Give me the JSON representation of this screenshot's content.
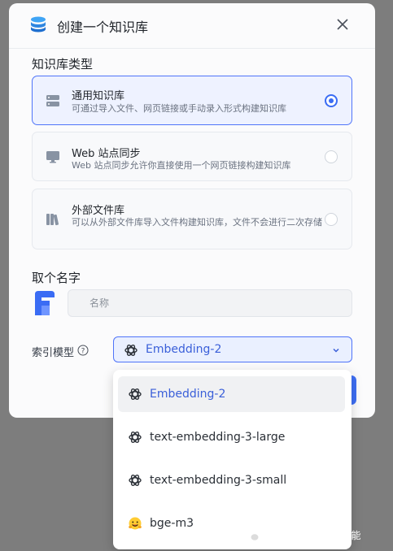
{
  "modal": {
    "title": "创建一个知识库",
    "icons": {
      "logo": "database-stack-icon",
      "close": "close-icon"
    }
  },
  "kb_type": {
    "section_title": "知识库类型",
    "options": [
      {
        "name": "通用知识库",
        "desc": "可通过导入文件、网页链接或手动录入形式构建知识库",
        "selected": true,
        "icon": "server-icon"
      },
      {
        "name": "Web 站点同步",
        "desc": "Web 站点同步允许你直接使用一个网页链接构建知识库",
        "selected": false,
        "icon": "monitor-icon"
      },
      {
        "name": "外部文件库",
        "desc": "可以从外部文件库导入文件构建知识库，文件不会进行二次存储",
        "selected": false,
        "icon": "library-icon"
      }
    ]
  },
  "name_section": {
    "title": "取个名字",
    "placeholder": "名称",
    "value": ""
  },
  "index_model": {
    "label": "索引模型",
    "selected": "Embedding-2",
    "options": [
      {
        "label": "Embedding-2",
        "icon": "openai-icon",
        "active": true
      },
      {
        "label": "text-embedding-3-large",
        "icon": "openai-icon",
        "active": false
      },
      {
        "label": "text-embedding-3-small",
        "icon": "openai-icon",
        "active": false
      },
      {
        "label": "bge-m3",
        "icon": "hugging-face-icon",
        "active": false
      }
    ]
  },
  "watermark": {
    "text": "公众号 · 汀丶人工智能"
  },
  "colors": {
    "accent": "#3a6cf4",
    "selected_bg": "#eef2ff",
    "overlay": "#7d7d7d"
  }
}
